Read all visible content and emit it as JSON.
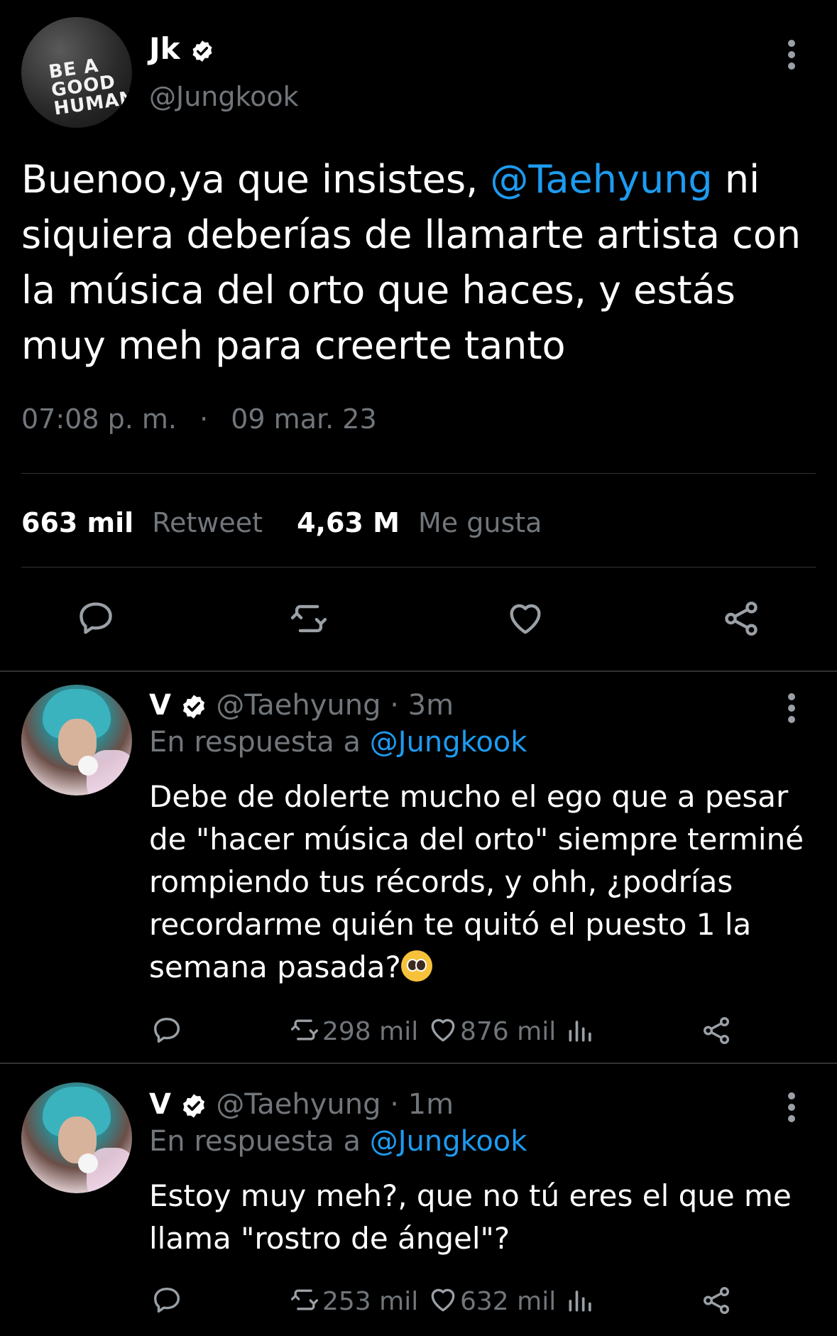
{
  "main_tweet": {
    "author_name": "Jk",
    "author_handle": "@Jungkook",
    "avatar_shirt_text": "BE A GOOD HUMAN",
    "text_before_mention": "Buenoo,ya que insistes, ",
    "mention": "@Taehyung",
    "text_after_mention": " ni siquiera deberías de llamarte artista con la música del orto que haces, y estás muy meh para creerte tanto",
    "time": "07:08 p. m.",
    "separator": "·",
    "date": "09 mar. 23",
    "retweet_count": "663 mil",
    "retweet_label": "Retweet",
    "like_count": "4,63 M",
    "like_label": "Me gusta"
  },
  "replies": [
    {
      "author_name": "V",
      "author_handle": "@Taehyung",
      "time_ago": "· 3m",
      "reply_prefix": "En respuesta a ",
      "reply_to": "@Jungkook",
      "text": "Debe de dolerte mucho el ego que a pesar de \"hacer música del orto\" siempre terminé rompiendo tus récords, y ohh, ¿podrías recordarme quién te quitó el puesto 1 la semana pasada?",
      "emoji": "pleading-face",
      "retweets": "298 mil",
      "likes": "876 mil"
    },
    {
      "author_name": "V",
      "author_handle": "@Taehyung",
      "time_ago": "· 1m",
      "reply_prefix": "En respuesta a ",
      "reply_to": "@Jungkook",
      "text": "Estoy muy meh?, que no tú eres el que me llama \"rostro de ángel\"?",
      "retweets": "253 mil",
      "likes": "632 mil"
    }
  ],
  "icons": {
    "reply": "reply-icon",
    "retweet": "retweet-icon",
    "like": "heart-icon",
    "share": "share-icon",
    "views": "analytics-icon",
    "more": "more-options-icon",
    "verified": "verified-badge-icon"
  },
  "colors": {
    "background": "#000000",
    "text": "#e7e9ea",
    "muted": "#71767b",
    "link": "#1d9bf0",
    "divider": "#2f3336"
  }
}
